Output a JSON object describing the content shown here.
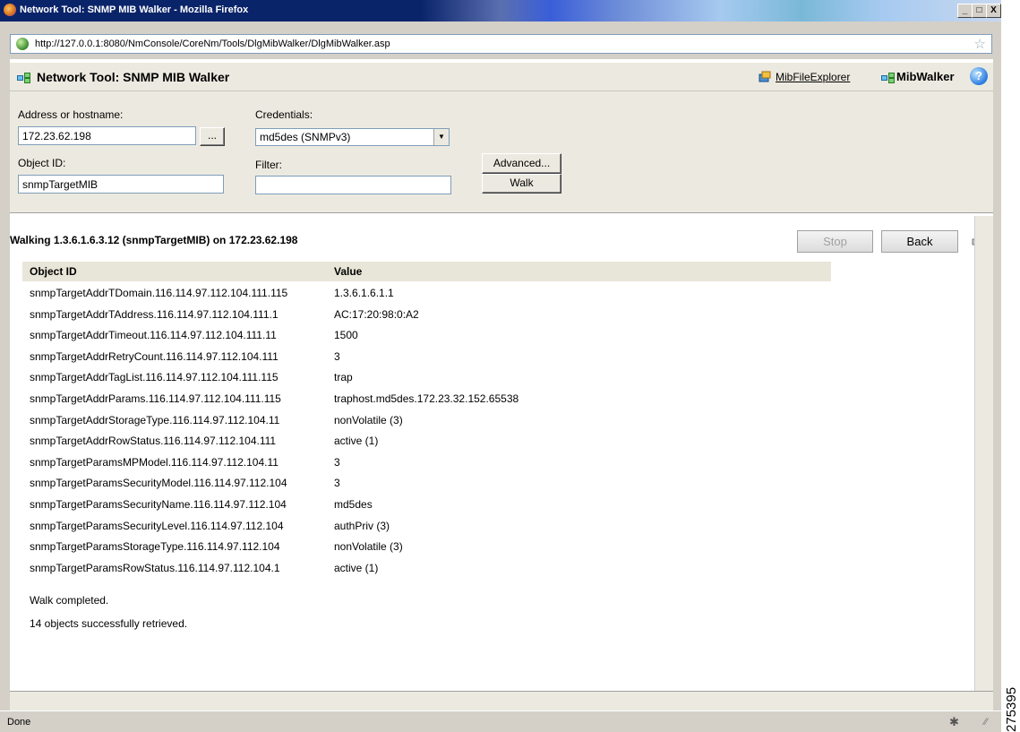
{
  "window": {
    "title": "Network Tool: SNMP MIB Walker - Mozilla Firefox",
    "min": "_",
    "max": "□",
    "close": "X"
  },
  "browser": {
    "url": "http://127.0.0.1:8080/NmConsole/CoreNm/Tools/DlgMibWalker/DlgMibWalker.asp",
    "star": "☆",
    "status": "Done"
  },
  "header": {
    "title": "Network Tool: SNMP MIB Walker",
    "mib_file_explorer": "MibFileExplorer",
    "mib_walker": "MibWalker",
    "help": "?"
  },
  "form": {
    "address_label": "Address or hostname:",
    "address_value": "172.23.62.198",
    "browse_label": "...",
    "credentials_label": "Credentials:",
    "credentials_value": "md5des (SNMPv3)",
    "object_id_label": "Object ID:",
    "object_id_value": "snmpTargetMIB",
    "filter_label": "Filter:",
    "filter_value": "",
    "advanced_label": "Advanced...",
    "walk_label": "Walk"
  },
  "results": {
    "heading": "Walking 1.3.6.1.6.3.12 (snmpTargetMIB) on 172.23.62.198",
    "stop_label": "Stop",
    "back_label": "Back",
    "columns": [
      "Object ID",
      "Value"
    ],
    "rows": [
      {
        "oid": "snmpTargetAddrTDomain.116.114.97.112.104.111.115",
        "value": "1.3.6.1.6.1.1"
      },
      {
        "oid": "snmpTargetAddrTAddress.116.114.97.112.104.111.1",
        "value": "AC:17:20:98:0:A2"
      },
      {
        "oid": "snmpTargetAddrTimeout.116.114.97.112.104.111.11",
        "value": "1500"
      },
      {
        "oid": "snmpTargetAddrRetryCount.116.114.97.112.104.111",
        "value": "3"
      },
      {
        "oid": "snmpTargetAddrTagList.116.114.97.112.104.111.115",
        "value": "trap"
      },
      {
        "oid": "snmpTargetAddrParams.116.114.97.112.104.111.115",
        "value": "traphost.md5des.172.23.32.152.65538"
      },
      {
        "oid": "snmpTargetAddrStorageType.116.114.97.112.104.11",
        "value": "nonVolatile (3)"
      },
      {
        "oid": "snmpTargetAddrRowStatus.116.114.97.112.104.111",
        "value": "active (1)"
      },
      {
        "oid": "snmpTargetParamsMPModel.116.114.97.112.104.11",
        "value": "3"
      },
      {
        "oid": "snmpTargetParamsSecurityModel.116.114.97.112.104",
        "value": "3"
      },
      {
        "oid": "snmpTargetParamsSecurityName.116.114.97.112.104",
        "value": "md5des"
      },
      {
        "oid": "snmpTargetParamsSecurityLevel.116.114.97.112.104",
        "value": "authPriv (3)"
      },
      {
        "oid": "snmpTargetParamsStorageType.116.114.97.112.104",
        "value": "nonVolatile (3)"
      },
      {
        "oid": "snmpTargetParamsRowStatus.116.114.97.112.104.1",
        "value": "active (1)"
      }
    ],
    "walk_completed": "Walk completed.",
    "summary": "14 objects successfully retrieved."
  },
  "side_id": "275395",
  "icons": [
    "firefox-icon",
    "globe-icon",
    "bookmark-star-icon",
    "network-icon",
    "mib-file-explorer-icon",
    "help-icon",
    "print-icon",
    "resize-grip-icon"
  ]
}
